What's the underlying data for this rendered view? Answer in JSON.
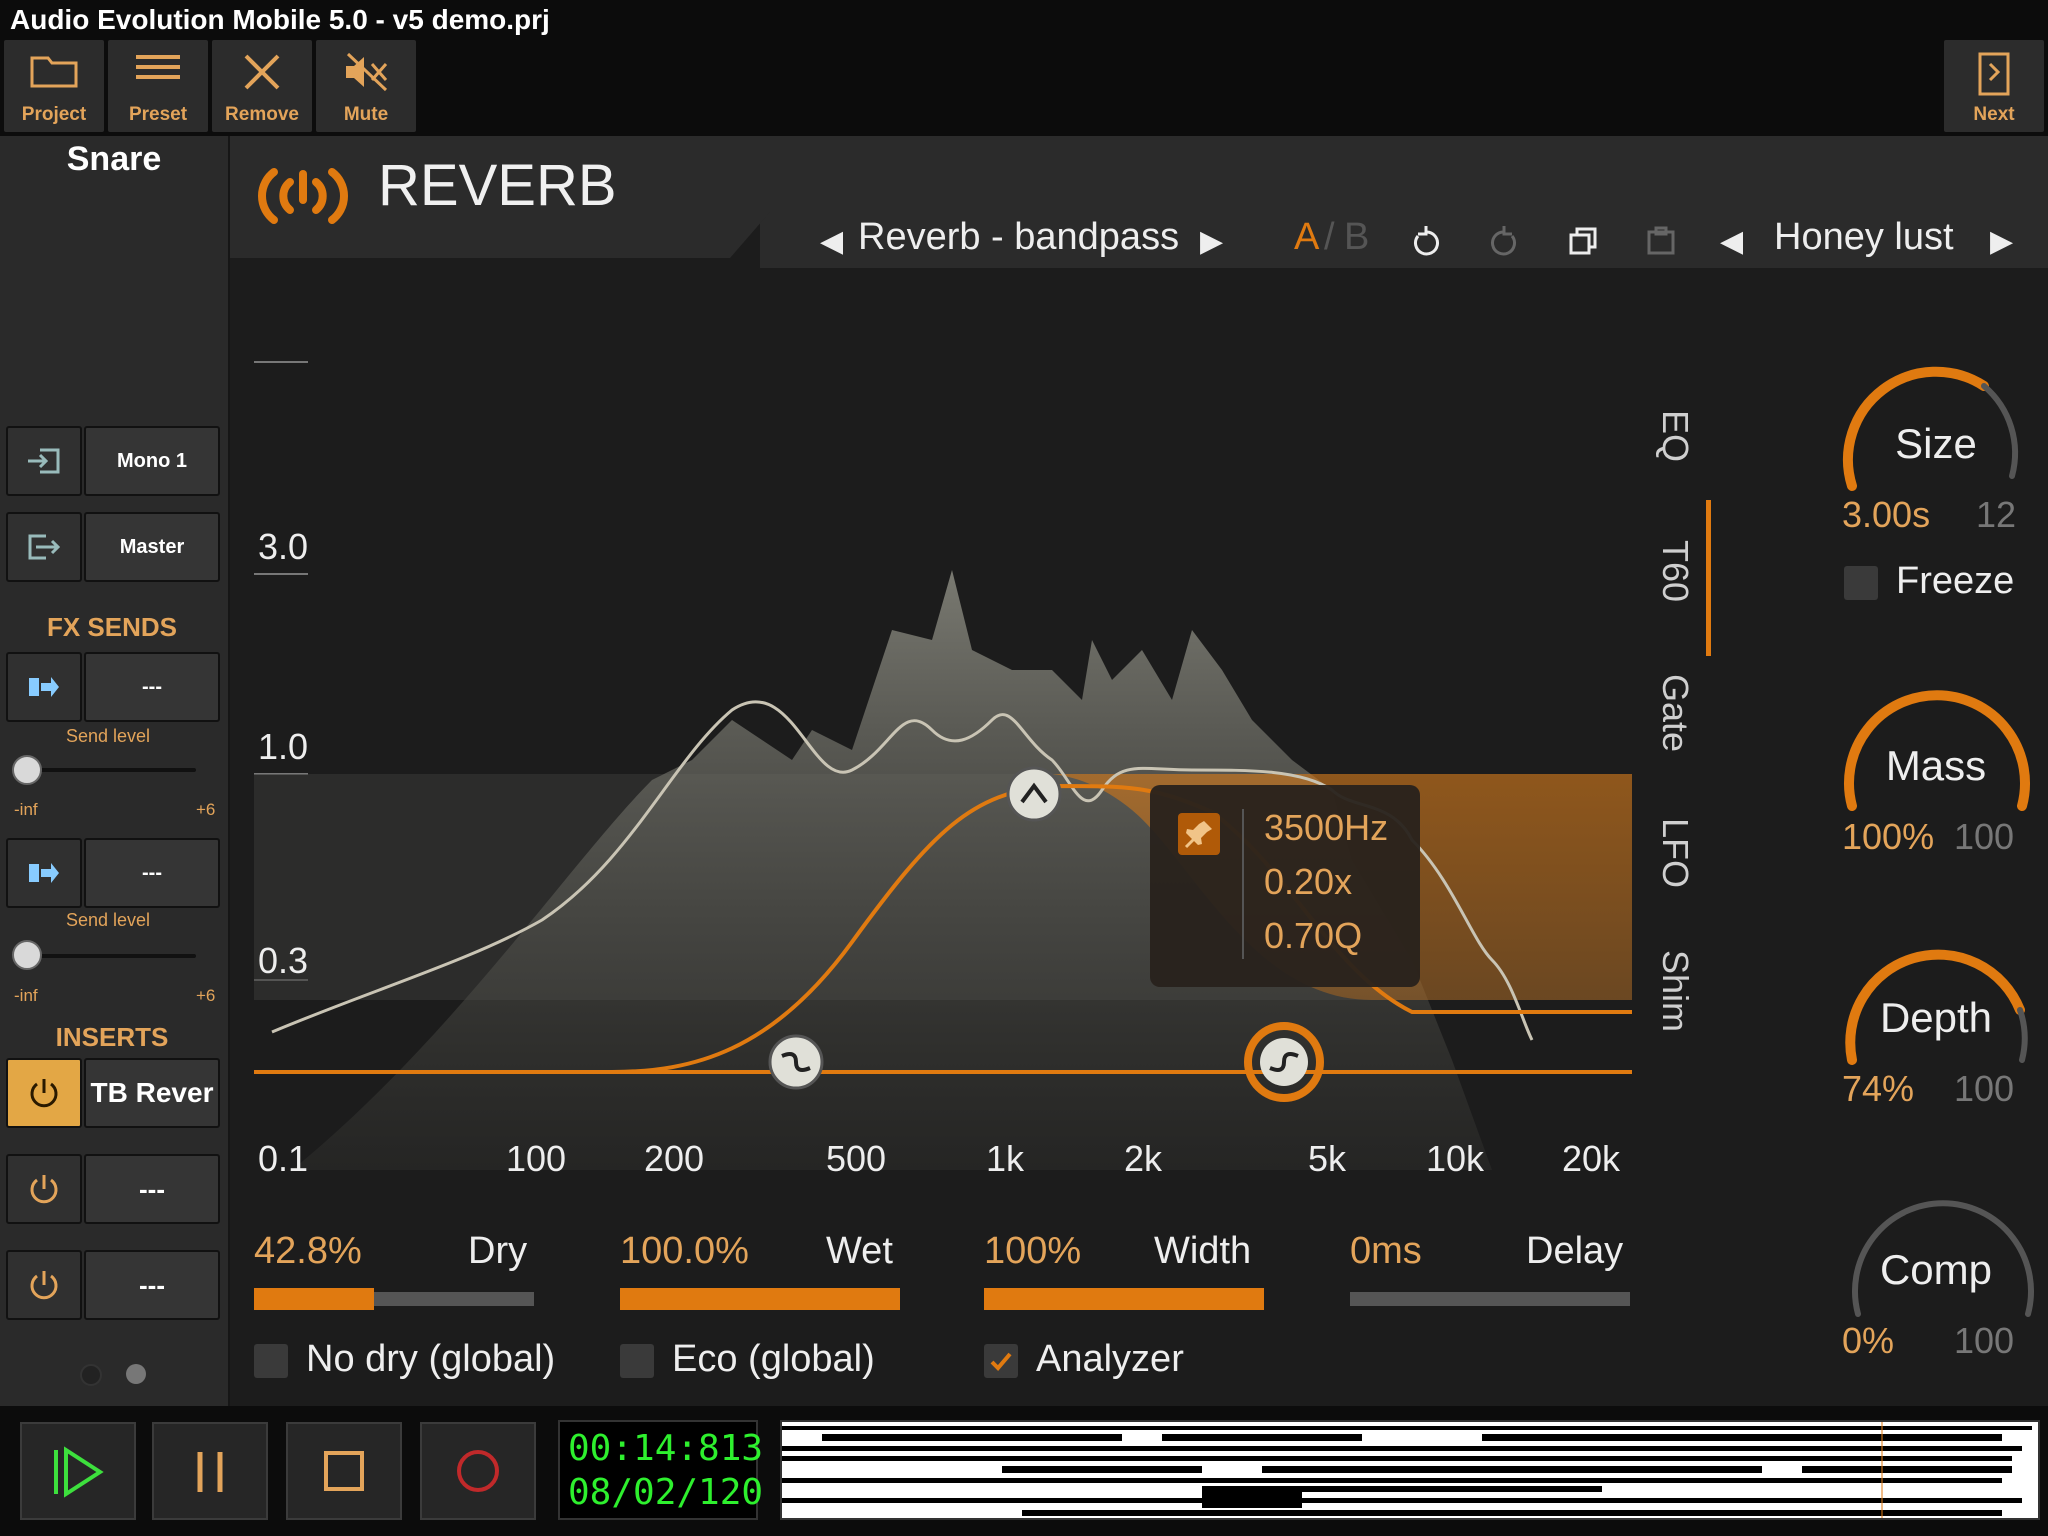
{
  "window": {
    "title": "Audio Evolution Mobile 5.0 - v5 demo.prj"
  },
  "toolbar": {
    "project": "Project",
    "preset": "Preset",
    "remove": "Remove",
    "mute": "Mute",
    "next": "Next"
  },
  "track": {
    "name": "Snare",
    "input": "Mono 1",
    "output": "Master"
  },
  "fx_sends": {
    "title": "FX SENDS",
    "sends": [
      {
        "target": "---",
        "label": "Send level",
        "min": "-inf",
        "max": "+6"
      },
      {
        "target": "---",
        "label": "Send level",
        "min": "-inf",
        "max": "+6"
      }
    ]
  },
  "inserts": {
    "title": "INSERTS",
    "slots": [
      {
        "name": "TB Rever",
        "active": true
      },
      {
        "name": "---",
        "active": false
      },
      {
        "name": "---",
        "active": false
      }
    ]
  },
  "plugin": {
    "title": "REVERB",
    "preset": "Reverb - bandpass",
    "ab_a": "A",
    "ab_sep": "/",
    "ab_b": "B",
    "bank_preset": "Honey lust"
  },
  "graph": {
    "y_labels": [
      "3.0",
      "1.0",
      "0.3"
    ],
    "x_labels": [
      "0.1",
      "100",
      "200",
      "500",
      "1k",
      "2k",
      "5k",
      "10k",
      "20k"
    ]
  },
  "tooltip": {
    "freq": "3500Hz",
    "mult": "0.20x",
    "q": "0.70Q"
  },
  "side_tabs": [
    "EQ",
    "T60",
    "Gate",
    "LFO",
    "Shim"
  ],
  "active_tab": "T60",
  "knobs": {
    "size": {
      "name": "Size",
      "value": "3.00s",
      "max": "12"
    },
    "freeze": "Freeze",
    "mass": {
      "name": "Mass",
      "value": "100%",
      "max": "100"
    },
    "depth": {
      "name": "Depth",
      "value": "74%",
      "max": "100"
    },
    "comp": {
      "name": "Comp",
      "value": "0%",
      "max": "100"
    }
  },
  "params": [
    {
      "value": "42.8%",
      "name": "Dry",
      "level": 0.428
    },
    {
      "value": "100.0%",
      "name": "Wet",
      "level": 1.0
    },
    {
      "value": "100%",
      "name": "Width",
      "level": 1.0
    },
    {
      "value": "0ms",
      "name": "Delay",
      "level": 0.0
    }
  ],
  "options": {
    "no_dry": "No dry (global)",
    "eco": "Eco (global)",
    "analyzer": "Analyzer",
    "analyzer_checked": true
  },
  "transport": {
    "time": "00:14:813",
    "position": "08/02/120"
  },
  "colors": {
    "accent": "#e07a10",
    "accent_text": "#e3a45a",
    "time_green": "#2ef02e"
  }
}
